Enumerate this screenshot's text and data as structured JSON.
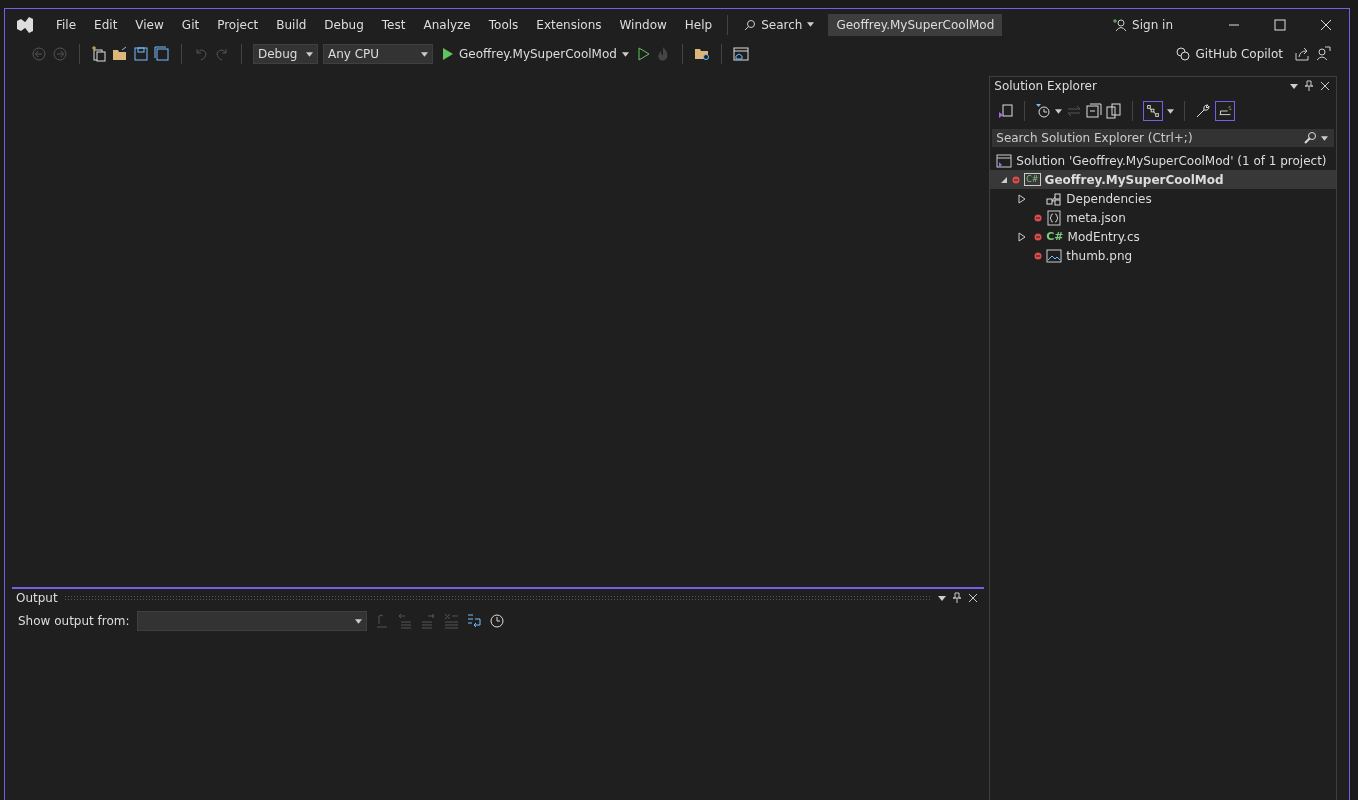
{
  "menu": [
    "File",
    "Edit",
    "View",
    "Git",
    "Project",
    "Build",
    "Debug",
    "Test",
    "Analyze",
    "Tools",
    "Extensions",
    "Window",
    "Help"
  ],
  "search": {
    "label": "Search"
  },
  "solution_name": "Geoffrey.MySuperCoolMod",
  "sign_in": "Sign in",
  "toolbar": {
    "configuration": "Debug",
    "platform": "Any CPU",
    "startup": "Geoffrey.MySuperCoolMod",
    "copilot": "GitHub Copilot"
  },
  "solution_explorer": {
    "title": "Solution Explorer",
    "search": {
      "placeholder": "Search Solution Explorer (Ctrl+;)"
    },
    "solution": "Solution 'Geoffrey.MySuperCoolMod' (1 of 1 project)",
    "tree": [
      {
        "label": "Geoffrey.MySuperCoolMod",
        "kind": "project",
        "icon_label": "C#",
        "expanded": true,
        "selected": true,
        "pending": true,
        "children": [
          {
            "label": "Dependencies",
            "kind": "deps",
            "expanded": false,
            "selected": false
          },
          {
            "label": "meta.json",
            "kind": "json",
            "selected": false,
            "pending": true
          },
          {
            "label": "ModEntry.cs",
            "kind": "csharp",
            "icon_label": "C#",
            "expanded": false,
            "selected": false,
            "pending": true
          },
          {
            "label": "thumb.png",
            "kind": "image",
            "selected": false,
            "pending": true
          }
        ]
      }
    ]
  },
  "output": {
    "title": "Output",
    "source_label": "Show output from:"
  }
}
